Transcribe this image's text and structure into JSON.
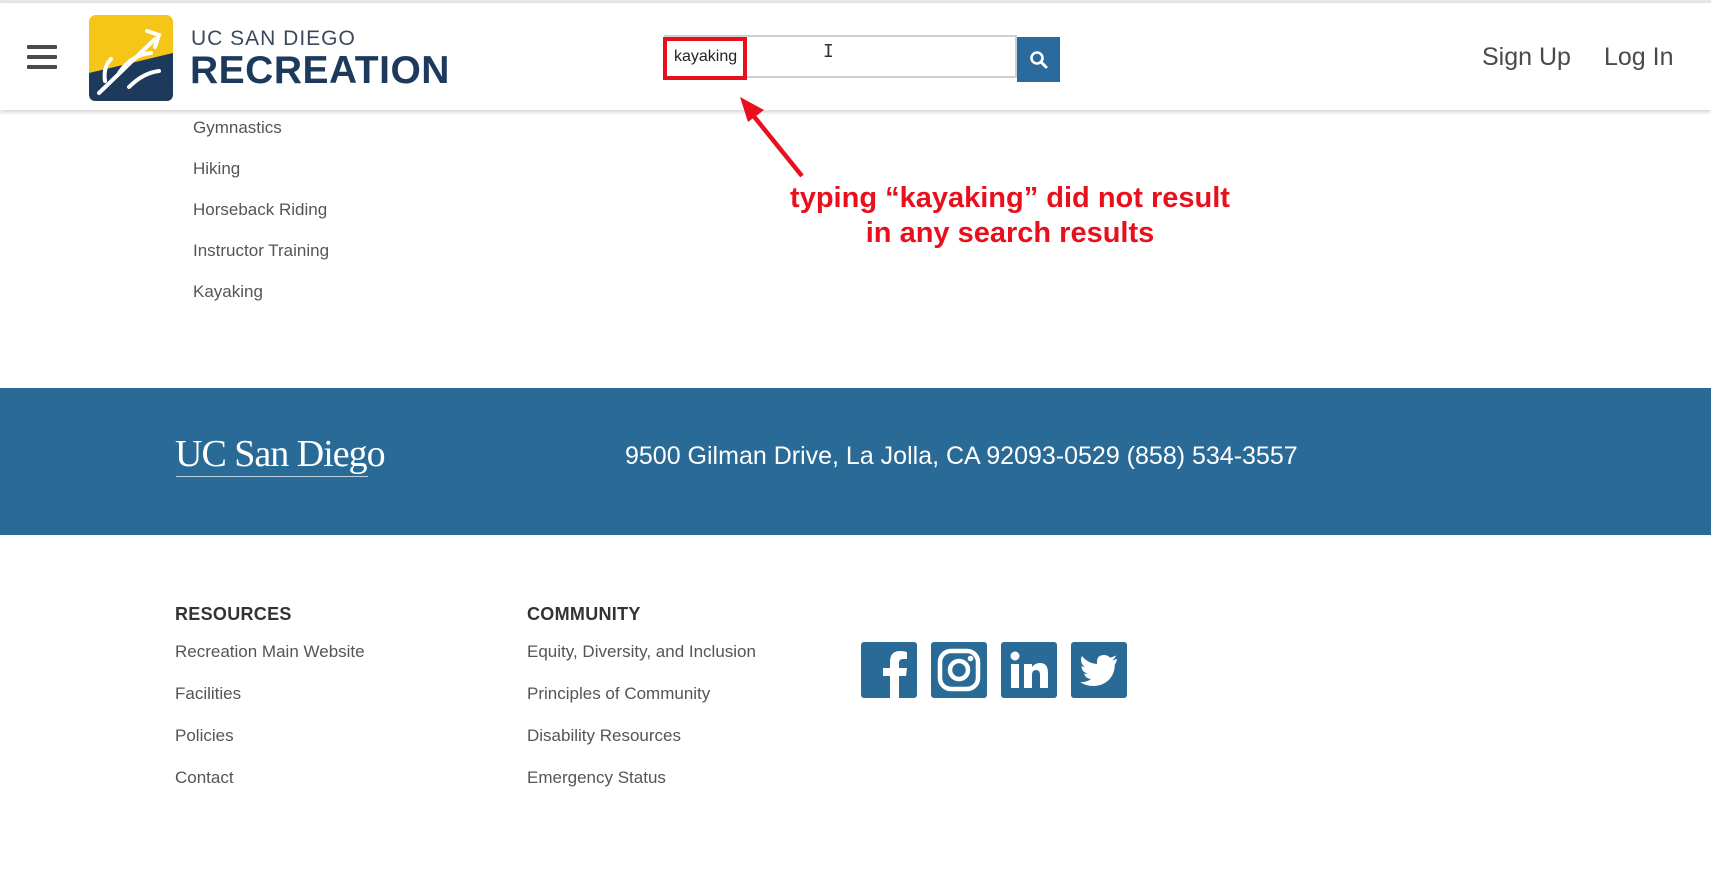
{
  "header": {
    "logo_top": "UC SAN DIEGO",
    "logo_bottom": "RECREATION",
    "search_value": "kayaking",
    "signup_label": "Sign Up",
    "login_label": "Log In"
  },
  "menu": {
    "items": [
      "Gymnastics",
      "Hiking",
      "Horseback Riding",
      "Instructor Training",
      "Kayaking"
    ]
  },
  "annotation": {
    "line1": "typing “kayaking” did not result",
    "line2": "in any search results"
  },
  "footer": {
    "logo_text": "UC San Diego",
    "address": "9500 Gilman Drive, La Jolla, CA 92093-0529 (858) 534-3557",
    "resources": {
      "title": "RESOURCES",
      "links": [
        "Recreation Main Website",
        "Facilities",
        "Policies",
        "Contact"
      ]
    },
    "community": {
      "title": "COMMUNITY",
      "links": [
        "Equity, Diversity, and Inclusion",
        "Principles of Community",
        "Disability Resources",
        "Emergency Status"
      ]
    },
    "social": [
      "facebook-icon",
      "instagram-icon",
      "linkedin-icon",
      "twitter-icon"
    ]
  },
  "colors": {
    "brand_blue": "#2a6a96",
    "annotation_red": "#e8101c",
    "logo_yellow": "#f5c518",
    "logo_navy": "#1d3a5c"
  }
}
